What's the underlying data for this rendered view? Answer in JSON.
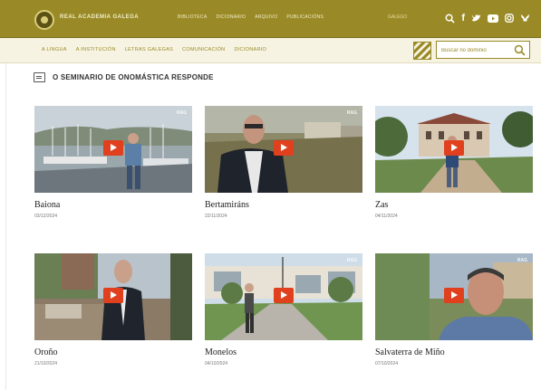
{
  "header": {
    "brand": "REAL ACADEMIA GALEGA",
    "nav": [
      "BIBLIOTECA",
      "DICIONARIO",
      "ARQUIVO",
      "PUBLICACIÓNS"
    ],
    "language": "GALEGO",
    "icons": [
      "search-icon",
      "facebook-icon",
      "twitter-icon",
      "youtube-icon",
      "instagram-icon",
      "bluesky-icon"
    ]
  },
  "subnav": {
    "items": [
      "A LINGUA",
      "A INSTITUCIÓN",
      "LETRAS GALEGAS",
      "COMUNICACIÓN",
      "DICIONARIO"
    ],
    "search_placeholder": "Buscar no dominio"
  },
  "section": {
    "title": "O SEMINARIO DE ONOMÁSTICA RESPONDE"
  },
  "videos": [
    {
      "title": "Baiona",
      "date": "03/12/2024"
    },
    {
      "title": "Bertamiráns",
      "date": "22/11/2024"
    },
    {
      "title": "Zas",
      "date": "04/11/2024"
    },
    {
      "title": "Oroño",
      "date": "21/10/2024"
    },
    {
      "title": "Monelos",
      "date": "04/10/2024"
    },
    {
      "title": "Salvaterra de Miño",
      "date": "07/10/2024"
    }
  ],
  "colors": {
    "brand": "#9a8a27",
    "play": "#e0401d"
  }
}
